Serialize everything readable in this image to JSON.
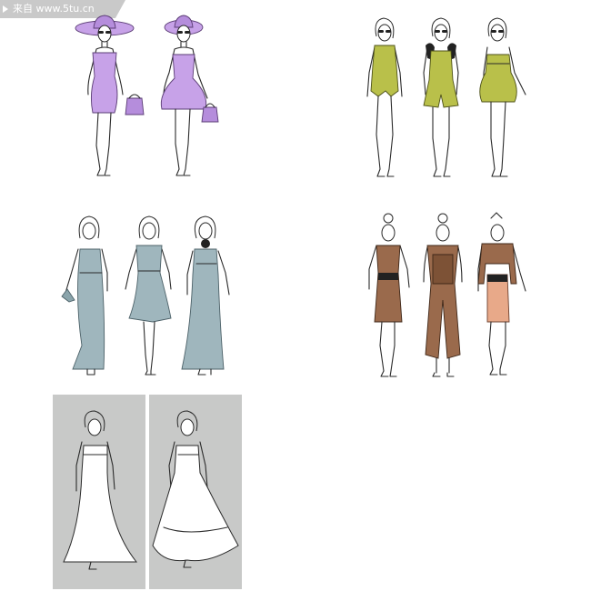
{
  "watermark": {
    "text": "来自 www.5tu.cn"
  },
  "groups": [
    {
      "name": "purple-dresses-with-hats",
      "count": 2,
      "color": "#c7a2e8"
    },
    {
      "name": "olive-rompers",
      "count": 3,
      "color": "#b9c04a"
    },
    {
      "name": "blue-gray-gowns",
      "count": 3,
      "color": "#9fb6bd"
    },
    {
      "name": "brown-outfits",
      "count": 3,
      "color": "#9a6a4c"
    },
    {
      "name": "white-wedding-dresses",
      "count": 2,
      "color": "#ffffff"
    }
  ],
  "colors": {
    "background": "#ffffff",
    "panel": "#c8c9c8",
    "outline": "#2a2a2a",
    "watermark_bg": "#c9c9c9"
  }
}
